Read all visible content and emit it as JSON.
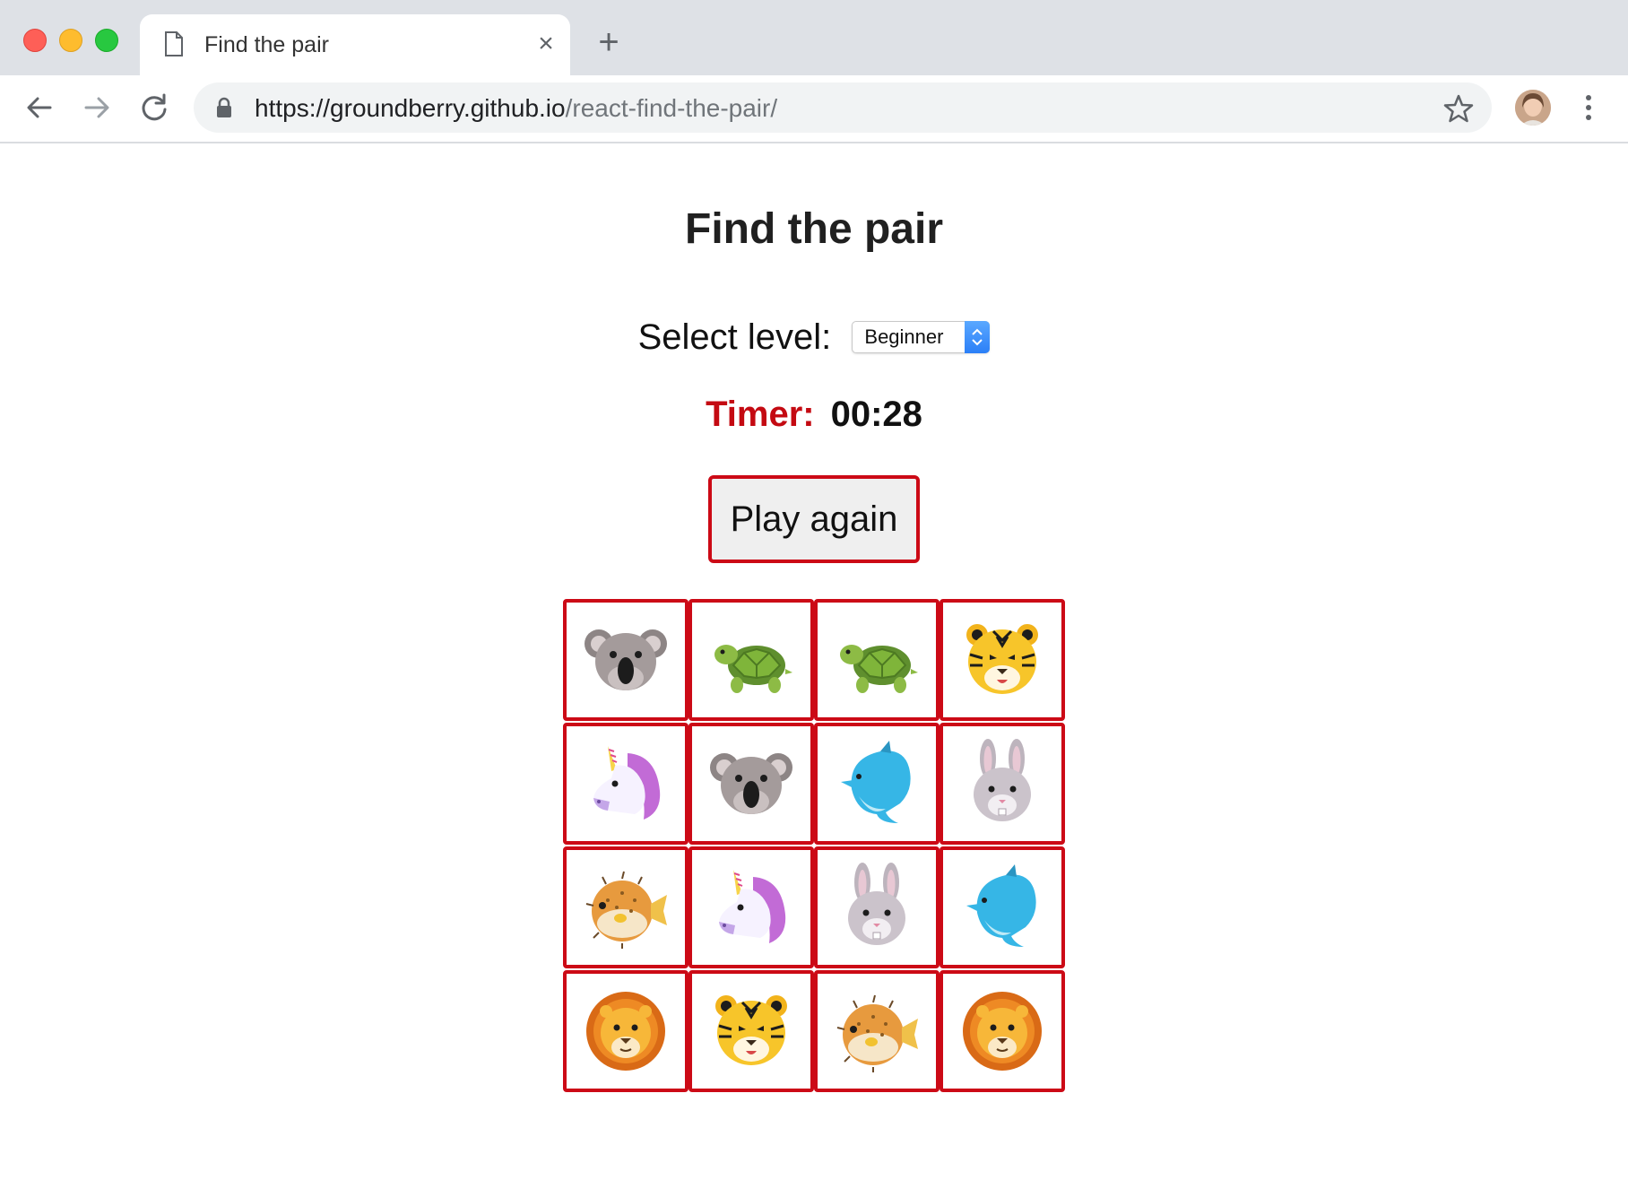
{
  "browser": {
    "tab_title": "Find the pair",
    "tab_close": "×",
    "new_tab": "+",
    "url_host": "https://groundberry.github.io",
    "url_path": "/react-find-the-pair/"
  },
  "page": {
    "title": "Find the pair",
    "level_label": "Select level:",
    "level_selected": "Beginner",
    "timer_label": "Timer:",
    "timer_value": "00:28",
    "play_again": "Play again"
  },
  "colors": {
    "accent_red": "#cc0a16",
    "timer_red": "#c40a12"
  },
  "cards": [
    {
      "icon": "koala-icon"
    },
    {
      "icon": "turtle-icon"
    },
    {
      "icon": "turtle-icon"
    },
    {
      "icon": "tiger-icon"
    },
    {
      "icon": "unicorn-icon"
    },
    {
      "icon": "koala-icon"
    },
    {
      "icon": "dolphin-icon"
    },
    {
      "icon": "rabbit-icon"
    },
    {
      "icon": "blowfish-icon"
    },
    {
      "icon": "unicorn-icon"
    },
    {
      "icon": "rabbit-icon"
    },
    {
      "icon": "dolphin-icon"
    },
    {
      "icon": "lion-icon"
    },
    {
      "icon": "tiger-icon"
    },
    {
      "icon": "blowfish-icon"
    },
    {
      "icon": "lion-icon"
    }
  ]
}
